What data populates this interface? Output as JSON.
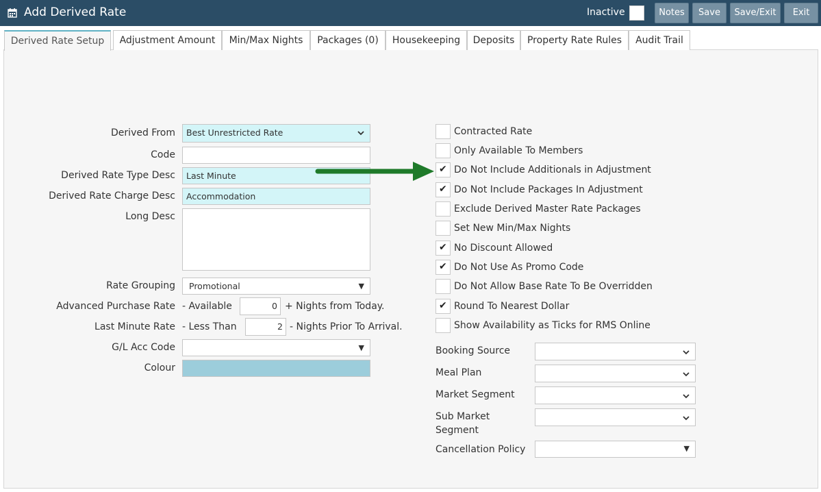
{
  "header": {
    "title": "Add Derived Rate",
    "inactive_label": "Inactive",
    "buttons": {
      "notes": "Notes",
      "save": "Save",
      "save_exit": "Save/Exit",
      "exit": "Exit"
    },
    "bar_color": "#2b4d66"
  },
  "tabs": [
    {
      "label": "Derived Rate Setup"
    },
    {
      "label": "Adjustment Amount"
    },
    {
      "label": "Min/Max Nights"
    },
    {
      "label": "Packages (0)"
    },
    {
      "label": "Housekeeping"
    },
    {
      "label": "Deposits"
    },
    {
      "label": "Property Rate Rules"
    },
    {
      "label": "Audit Trail"
    }
  ],
  "form": {
    "derived_from": {
      "label": "Derived From",
      "value": "Best Unrestricted Rate"
    },
    "code": {
      "label": "Code",
      "value": ""
    },
    "type_desc": {
      "label": "Derived Rate Type Desc",
      "value": "Last Minute"
    },
    "charge_desc": {
      "label": "Derived Rate Charge Desc",
      "value": "Accommodation"
    },
    "long_desc": {
      "label": "Long Desc",
      "value": ""
    },
    "rate_grouping": {
      "label": "Rate Grouping",
      "value": "Promotional"
    },
    "advanced_purchase": {
      "label": "Advanced Purchase Rate",
      "prefix": "- Available",
      "value": "0",
      "suffix": "+ Nights from Today."
    },
    "last_minute": {
      "label": "Last Minute Rate",
      "prefix": "- Less Than",
      "value": "2",
      "suffix": "- Nights Prior To Arrival."
    },
    "gl_code": {
      "label": "G/L Acc Code",
      "value": ""
    },
    "colour": {
      "label": "Colour",
      "value": "#9ccddb"
    }
  },
  "checkboxes": [
    {
      "label": "Contracted Rate",
      "checked": false
    },
    {
      "label": "Only Available To Members",
      "checked": false
    },
    {
      "label": "Do Not Include Additionals in Adjustment",
      "checked": true
    },
    {
      "label": "Do Not Include Packages In Adjustment",
      "checked": true
    },
    {
      "label": "Exclude Derived Master Rate Packages",
      "checked": false
    },
    {
      "label": "Set New Min/Max Nights",
      "checked": false
    },
    {
      "label": "No Discount Allowed",
      "checked": true
    },
    {
      "label": "Do Not Use As Promo Code",
      "checked": true
    },
    {
      "label": "Do Not Allow Base Rate To Be Overridden",
      "checked": false
    },
    {
      "label": "Round To Nearest Dollar",
      "checked": true
    },
    {
      "label": "Show Availability as Ticks for RMS Online",
      "checked": false
    }
  ],
  "selects": {
    "booking_source": {
      "label": "Booking Source",
      "value": ""
    },
    "meal_plan": {
      "label": "Meal Plan",
      "value": ""
    },
    "market_segment": {
      "label": "Market Segment",
      "value": ""
    },
    "sub_market_line1": "Sub Market",
    "sub_market_line2": "Segment",
    "sub_market_value": "",
    "cancellation": {
      "label": "Cancellation Policy",
      "value": ""
    }
  },
  "annotation_arrow_color": "#1f7a2a"
}
